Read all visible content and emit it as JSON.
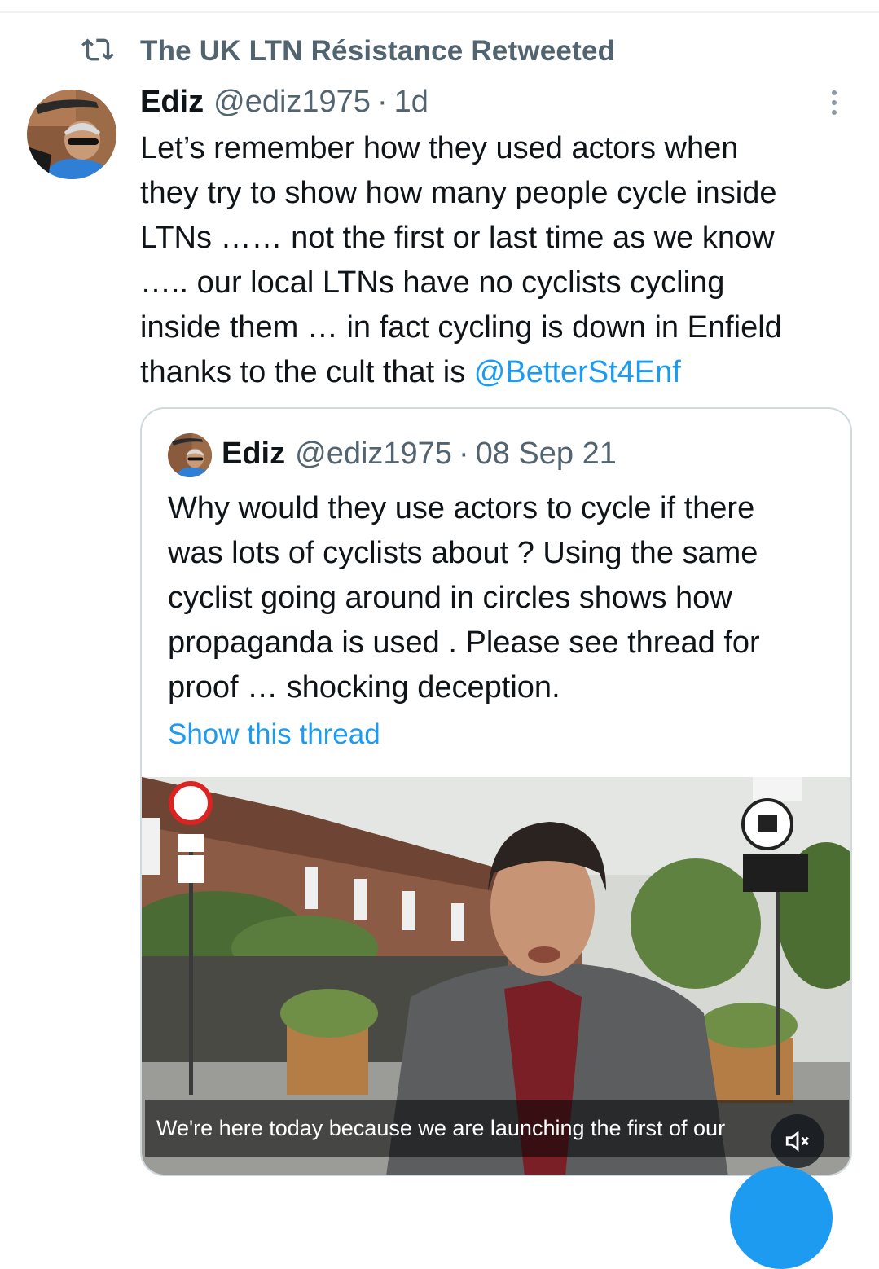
{
  "retweet": {
    "icon": "retweet-icon",
    "text": "The UK LTN Résistance Retweeted"
  },
  "tweet": {
    "name": "Ediz",
    "handle": "@ediz1975",
    "separator": "·",
    "time": "1d",
    "lines": [
      "Let’s remember how they used actors when",
      "they try to show how many people cycle inside",
      "LTNs …… not the first or last time as we know",
      "….. our local LTNs have no cyclists cycling",
      "inside them … in fact cycling is down in Enfield"
    ],
    "last_line_prefix": "thanks to the cult that is ",
    "mention": "@BetterSt4Enf"
  },
  "quote": {
    "name": "Ediz",
    "handle": "@ediz1975",
    "separator": "·",
    "date": "08 Sep 21",
    "lines": [
      "Why would they use actors to cycle if there",
      "was lots of cyclists about ? Using the same",
      "cyclist going around in circles shows how",
      "propaganda is used . Please see thread for",
      "proof … shocking deception."
    ],
    "show_thread": "Show this thread",
    "video": {
      "caption": "We're here today because we are launching the first of our",
      "mute_icon": "speaker-muted-icon"
    }
  },
  "colors": {
    "text": "#0f1419",
    "secondary": "#536471",
    "link": "#1d9bf0",
    "border": "#cfd9de"
  }
}
